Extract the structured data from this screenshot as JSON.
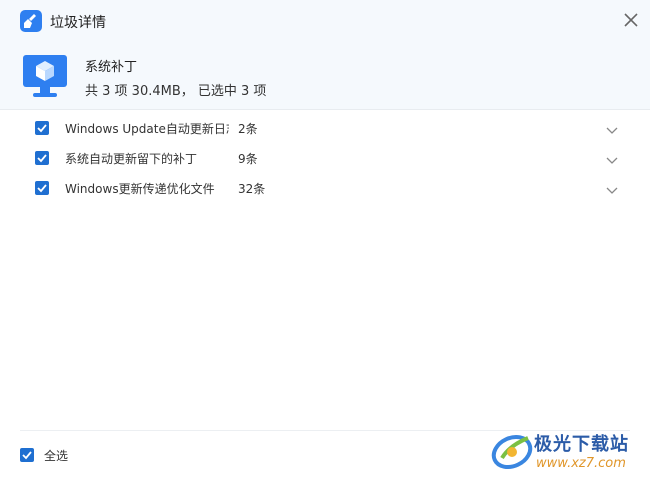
{
  "window": {
    "title": "垃圾详情",
    "icon": "broom-icon",
    "close_icon": "close-icon"
  },
  "category": {
    "icon": "monitor-cube-icon",
    "title": "系统补丁",
    "summary": "共 3 项 30.4MB， 已选中 3 项"
  },
  "items": [
    {
      "name": "Windows Update自动更新日志",
      "count": "2条",
      "checked": true
    },
    {
      "name": "系统自动更新留下的补丁",
      "count": "9条",
      "checked": true
    },
    {
      "name": "Windows更新传递优化文件",
      "count": "32条",
      "checked": true
    }
  ],
  "footer": {
    "select_all_label": "全选",
    "select_all_checked": true
  },
  "watermark": {
    "brand": "极光下载站",
    "url": "www.xz7.com"
  },
  "colors": {
    "accent": "#1f6fd1",
    "header_bg": "#f5f9fd",
    "icon_blue": "#2e7ff0"
  }
}
